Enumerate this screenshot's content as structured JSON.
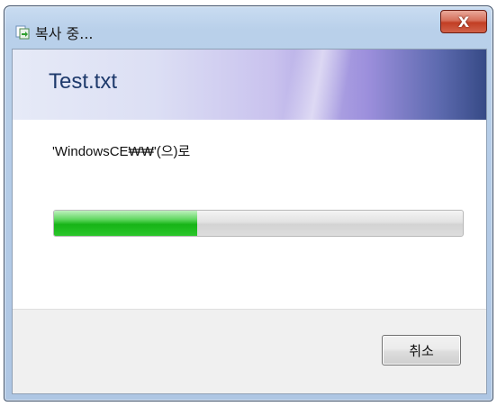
{
  "window": {
    "title": "복사 중...",
    "close_label": "X"
  },
  "dialog": {
    "file_name": "Test.txt",
    "destination_text": "'WindowsCE₩₩'(으)로",
    "progress": 0.35
  },
  "buttons": {
    "cancel_label": "취소"
  },
  "colors": {
    "progress_green": "#16b416",
    "close_red": "#c23e24",
    "file_name_blue": "#1e3a6c"
  },
  "icons": {
    "app": "copy-icon"
  }
}
